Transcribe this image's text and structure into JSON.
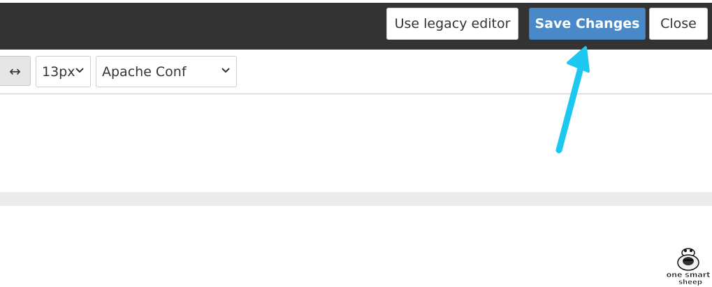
{
  "header": {
    "legacy_label": "Use legacy editor",
    "save_label": "Save Changes",
    "close_label": "Close"
  },
  "toolbar": {
    "wrap_icon": "↔",
    "font_size": "13px",
    "mode": "Apache Conf"
  },
  "logo": {
    "line1": "one smart",
    "line2": "sheep"
  },
  "colors": {
    "header_bg": "#333333",
    "save_bg": "#4a89c8",
    "arrow": "#1cc8f0"
  }
}
